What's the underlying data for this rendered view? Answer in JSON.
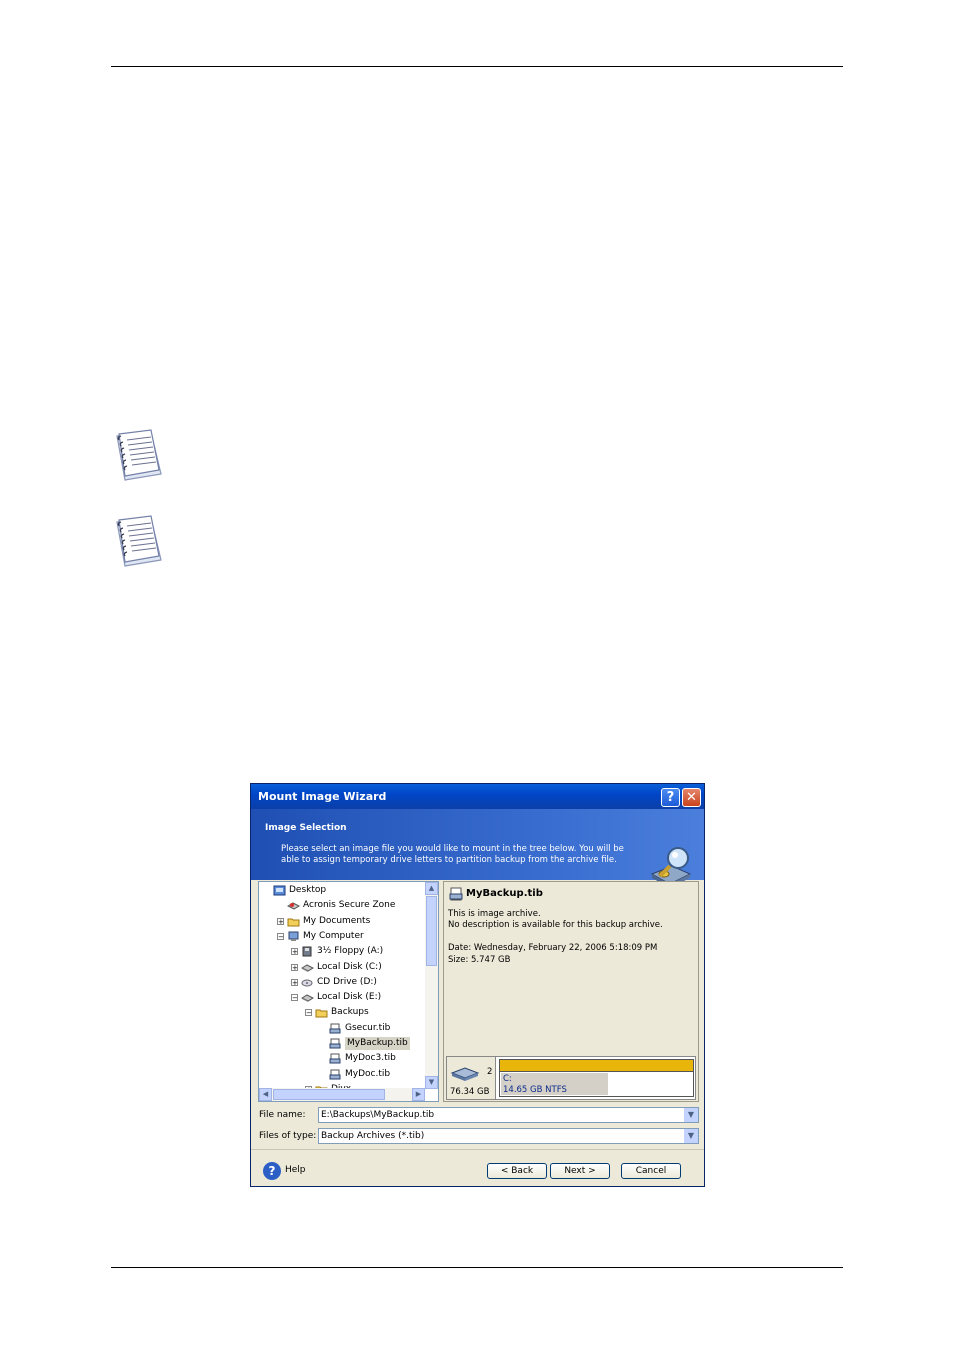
{
  "dialog": {
    "title": "Mount Image Wizard",
    "help_glyph": "?",
    "close_glyph": "✕",
    "header_title": "Image Selection",
    "header_description": "Please select an image file you would like to mount in the tree below. You will be able to assign temporary drive letters to partition backup from the archive file.",
    "tree": [
      {
        "label": "Desktop",
        "expander": ""
      },
      {
        "label": "Acronis Secure Zone",
        "expander": ""
      },
      {
        "label": "My Documents",
        "expander": "+"
      },
      {
        "label": "My Computer",
        "expander": "−"
      },
      {
        "label": "3½ Floppy (A:)",
        "expander": "+"
      },
      {
        "label": "Local Disk (C:)",
        "expander": "+"
      },
      {
        "label": "CD Drive (D:)",
        "expander": "+"
      },
      {
        "label": "Local Disk (E:)",
        "expander": "−"
      },
      {
        "label": "Backups",
        "expander": "−"
      },
      {
        "label": "Gsecur.tib",
        "expander": ""
      },
      {
        "label": "MyBackup.tib",
        "expander": "",
        "selected": true
      },
      {
        "label": "MyDoc3.tib",
        "expander": ""
      },
      {
        "label": "MyDoc.tib",
        "expander": ""
      },
      {
        "label": "Divx",
        "expander": "+"
      }
    ],
    "info": {
      "file_name": "MyBackup.tib",
      "line1": "This is image archive.",
      "line2": "No description is available for this backup archive.",
      "date": "Date: Wednesday, February 22, 2006 5:18:09 PM",
      "size": "Size: 5.747 GB",
      "disk_number": "2",
      "disk_size": "76.34 GB",
      "partition_letter": "C:",
      "partition_detail": "14.65 GB  NTFS"
    },
    "file_name_label": "File name:",
    "file_name_value": "E:\\Backups\\MyBackup.tib",
    "files_type_label": "Files of type:",
    "files_type_value": "Backup Archives (*.tib)",
    "help_label": "Help",
    "back_label": "< Back",
    "next_label": "Next >",
    "cancel_label": "Cancel"
  }
}
